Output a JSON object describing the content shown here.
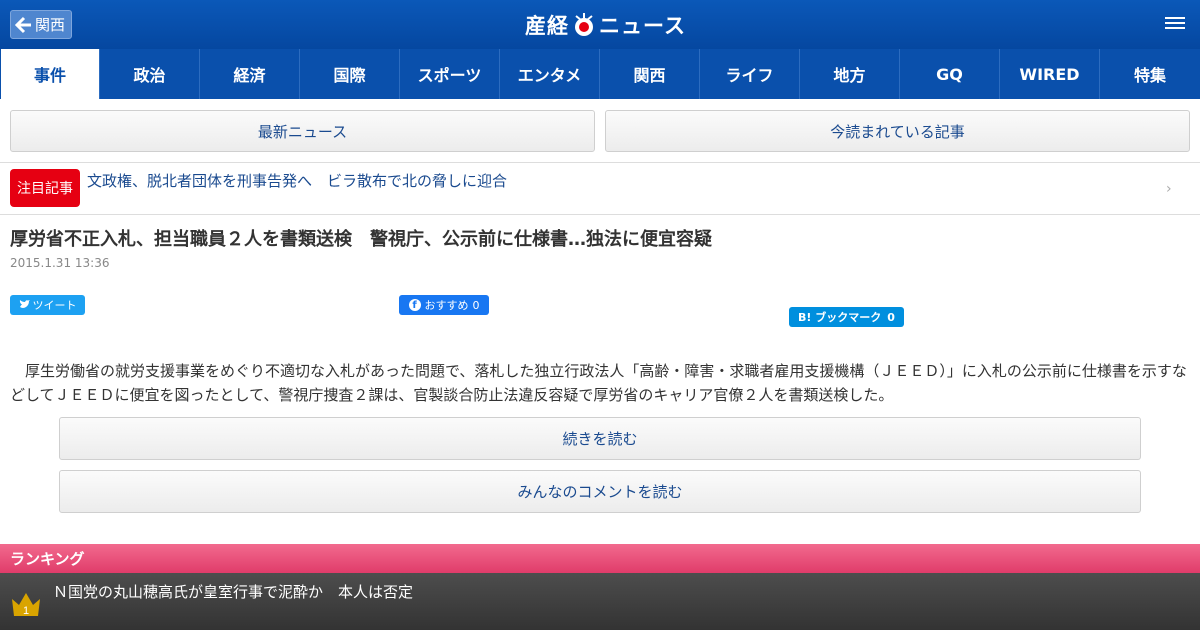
{
  "header": {
    "back_label": "関西",
    "logo_text_1": "産経",
    "logo_text_2": "ニュース"
  },
  "nav": {
    "items": [
      {
        "label": "事件"
      },
      {
        "label": "政治"
      },
      {
        "label": "経済"
      },
      {
        "label": "国際"
      },
      {
        "label": "スポーツ"
      },
      {
        "label": "エンタメ"
      },
      {
        "label": "関西"
      },
      {
        "label": "ライフ"
      },
      {
        "label": "地方"
      },
      {
        "label": "GQ"
      },
      {
        "label": "WIRED"
      },
      {
        "label": "特集"
      }
    ]
  },
  "sub_buttons": {
    "latest": "最新ニュース",
    "popular": "今読まれている記事"
  },
  "featured": {
    "badge": "注目記事",
    "link": "文政権、脱北者団体を刑事告発へ　ビラ散布で北の脅しに迎合"
  },
  "article": {
    "title": "厚労省不正入札、担当職員２人を書類送検　警視庁、公示前に仕様書…独法に便宜容疑",
    "date": "2015.1.31 13:36",
    "body": "　厚生労働省の就労支援事業をめぐり不適切な入札があった問題で、落札した独立行政法人「高齢・障害・求職者雇用支援機構（ＪＥＥＤ）」に入札の公示前に仕様書を示すなどしてＪＥＥＤに便宜を図ったとして、警視庁捜査２課は、官製談合防止法違反容疑で厚労省のキャリア官僚２人を書類送検した。",
    "read_more": "続きを読む",
    "comments": "みんなのコメントを読む"
  },
  "share": {
    "tweet": "ツイート",
    "fb": "おすすめ",
    "fb_count": "0",
    "hatena": "B! ブックマーク",
    "hatena_count": "0"
  },
  "ranking": {
    "header": "ランキング",
    "rank": "1",
    "item": "Ｎ国党の丸山穂高氏が皇室行事で泥酔か　本人は否定"
  },
  "colors": {
    "brand": "#0a50ac",
    "featured_badge": "#e60012",
    "ranking": "#e03c6a"
  }
}
